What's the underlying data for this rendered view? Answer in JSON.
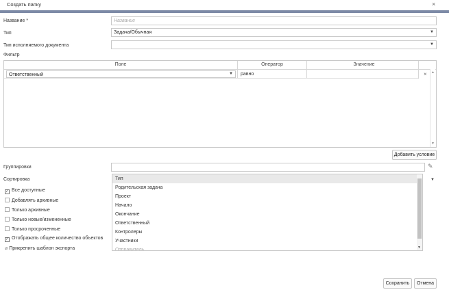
{
  "dialog": {
    "title": "Создать папку",
    "close_glyph": "×"
  },
  "form": {
    "name_label": "Название *",
    "name_placeholder": "Название",
    "type_label": "Тип",
    "type_value": "Задача/Обычная",
    "doc_type_label": "Тип исполняемого документа",
    "doc_type_value": "",
    "filter_label": "Фильтр",
    "grouping_label": "Группировки",
    "sort_label": "Сортировка"
  },
  "filter": {
    "columns": [
      "Поле",
      "Оператор",
      "Значение"
    ],
    "rows": [
      {
        "field": "Ответственный",
        "operator": "равно",
        "value": "",
        "remove_glyph": "×"
      }
    ],
    "add_condition_label": "Добавить условие"
  },
  "options": [
    {
      "label": "Все доступные",
      "checked": true
    },
    {
      "label": "Добавлять архивные",
      "checked": false
    },
    {
      "label": "Только архивные",
      "checked": false
    },
    {
      "label": "Только новые/измененные",
      "checked": false
    },
    {
      "label": "Только просроченные",
      "checked": false
    },
    {
      "label": "Отображать общее количество объектов",
      "checked": true
    }
  ],
  "attach_template_label": "Прикрепить шаблон экспорта",
  "grouping_dropdown": {
    "items": [
      "Тип",
      "Родительская задача",
      "Проект",
      "Начало",
      "Окончание",
      "Ответственный",
      "Контролеры",
      "Участники",
      "Отправитель"
    ],
    "selected_index": 0
  },
  "buttons": {
    "save": "Сохранить",
    "cancel": "Отмена"
  },
  "icons": {
    "dropdown_arrow": "▼",
    "scroll_up": "▲",
    "pencil": "✎",
    "paperclip": "📎"
  },
  "colors": {
    "accent_bar": "#7d8aa6",
    "selected_item": "#e9e9e9"
  }
}
